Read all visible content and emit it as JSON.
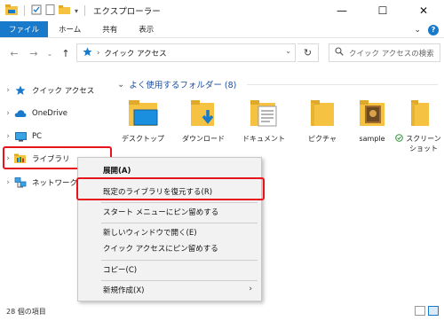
{
  "window": {
    "title": "エクスプローラー",
    "controls": {
      "minimize": "—",
      "maximize": "☐",
      "close": "✕"
    }
  },
  "ribbon": {
    "tabs": [
      {
        "label": "ファイル",
        "active": true
      },
      {
        "label": "ホーム"
      },
      {
        "label": "共有"
      },
      {
        "label": "表示"
      }
    ],
    "expand_icon": "chevron-down-icon",
    "help_icon": "help-icon",
    "help_label": "?"
  },
  "address_bar": {
    "path": [
      "クイック アクセス"
    ],
    "separator": "›",
    "search_placeholder": "クイック アクセスの検索"
  },
  "sidebar": {
    "items": [
      {
        "label": "クイック アクセス",
        "icon": "star-icon"
      },
      {
        "label": "OneDrive",
        "icon": "cloud-icon"
      },
      {
        "label": "PC",
        "icon": "computer-icon"
      },
      {
        "label": "ライブラリ",
        "icon": "library-icon",
        "highlighted": true
      },
      {
        "label": "ネットワーク",
        "icon": "network-icon"
      }
    ]
  },
  "main": {
    "group_title": "よく使用するフォルダー (8)",
    "items": [
      {
        "label": "デスクトップ",
        "icon": "desktop-folder-icon"
      },
      {
        "label": "ダウンロード",
        "icon": "downloads-folder-icon"
      },
      {
        "label": "ドキュメント",
        "icon": "documents-folder-icon"
      },
      {
        "label": "ピクチャ",
        "icon": "pictures-folder-icon"
      },
      {
        "label": "sample",
        "icon": "folder-icon"
      },
      {
        "label": "スクリーン\nショット",
        "icon": "screenshots-folder-icon"
      }
    ]
  },
  "context_menu": {
    "items": [
      {
        "label": "展開(A)",
        "bold": true
      },
      {
        "label": "既定のライブラリを復元する(R)",
        "highlighted": true
      },
      {
        "label": "スタート メニューにピン留めする"
      },
      {
        "label": "新しいウィンドウで開く(E)"
      },
      {
        "label": "クイック アクセスにピン留めする"
      },
      {
        "label": "コピー(C)"
      },
      {
        "label": "新規作成(X)",
        "submenu": true,
        "arrow": "›"
      }
    ]
  },
  "status_bar": {
    "text": "28 個の項目"
  },
  "colors": {
    "accent": "#1979ca",
    "highlight": "#e8141c",
    "folder": "#f5c341"
  }
}
